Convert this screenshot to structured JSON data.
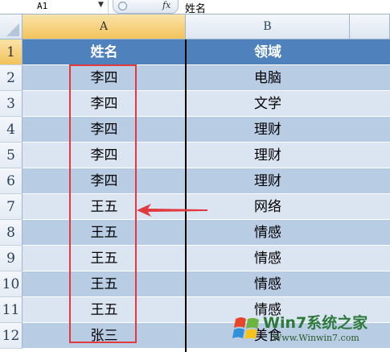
{
  "formula_bar": {
    "name_box": "A1",
    "fx_label": "fx",
    "value": "姓名"
  },
  "columns": [
    "A",
    "B"
  ],
  "rows": [
    {
      "num": "1",
      "name": "姓名",
      "domain": "领域"
    },
    {
      "num": "2",
      "name": "李四",
      "domain": "电脑"
    },
    {
      "num": "3",
      "name": "李四",
      "domain": "文学"
    },
    {
      "num": "4",
      "name": "李四",
      "domain": "理财"
    },
    {
      "num": "5",
      "name": "李四",
      "domain": "理财"
    },
    {
      "num": "6",
      "name": "李四",
      "domain": "理财"
    },
    {
      "num": "7",
      "name": "王五",
      "domain": "网络"
    },
    {
      "num": "8",
      "name": "王五",
      "domain": "情感"
    },
    {
      "num": "9",
      "name": "王五",
      "domain": "情感"
    },
    {
      "num": "10",
      "name": "王五",
      "domain": "情感"
    },
    {
      "num": "11",
      "name": "王五",
      "domain": "情感"
    },
    {
      "num": "12",
      "name": "张三",
      "domain": "美食"
    }
  ],
  "watermark": {
    "logo_text": "Win7系统之家",
    "url": "Www.Winwin7.com"
  },
  "colors": {
    "header_fill": "#4f81bd",
    "band_dark": "#b8cce4",
    "band_light": "#dbe5f1",
    "annotation_red": "#e0393e",
    "selection_gold": "#f2c35b"
  }
}
